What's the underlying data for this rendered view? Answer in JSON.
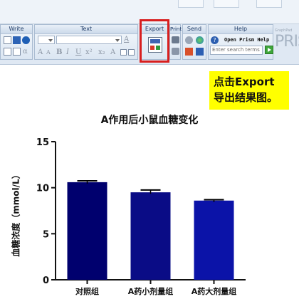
{
  "toolbar": {
    "groups": {
      "write": "Write",
      "text": "Text",
      "export": "Export",
      "print": "Print",
      "send": "Send",
      "help": "Help"
    },
    "open_prism_help": "Open Prism Help",
    "search_placeholder": "Enter search terms",
    "brand": "PRIS",
    "brand_small": "GraphPad",
    "format_glyphs": [
      "A",
      "A",
      "B",
      "I",
      "U",
      "x²",
      "x₂",
      "A"
    ]
  },
  "callout": {
    "line1": "点击Export",
    "line2": "导出结果图。",
    "color": "#ffff00"
  },
  "chart_data": {
    "type": "bar",
    "title": "A作用后小鼠血糖变化",
    "ylabel": "血糖浓度（mmol/L）",
    "xlabel": "",
    "categories": [
      "对照组",
      "A药小剂量组",
      "A药大剂量组"
    ],
    "values": [
      10.6,
      9.5,
      8.6
    ],
    "errors": [
      0.15,
      0.25,
      0.1
    ],
    "ylim": [
      0,
      15
    ],
    "yticks": [
      0,
      5,
      10,
      15
    ],
    "ytick_labels": [
      "0",
      "5",
      "10",
      "15"
    ],
    "bar_colors": [
      "#00006e",
      "#0a0c86",
      "#0b13a8"
    ],
    "grid": false
  }
}
